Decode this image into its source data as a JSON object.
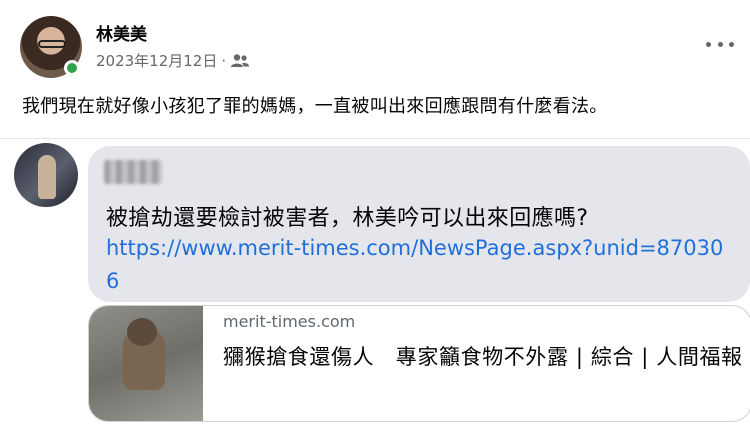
{
  "post": {
    "author": "林美美",
    "date": "2023年12月12日",
    "separator": "·",
    "audience_icon": "friends-icon",
    "text": "我們現在就好像小孩犯了罪的媽媽，一直被叫出來回應跟問有什麼看法。"
  },
  "comment": {
    "text": "被搶劫還要檢討被害者，林美吟可以出來回應嗎?",
    "link": "https://www.merit-times.com/NewsPage.aspx?unid=870306",
    "preview": {
      "domain": "merit-times.com",
      "title": "獼猴搶食還傷人　專家籲食物不外露 | 綜合 | 人間福報"
    }
  },
  "colors": {
    "link": "#216fdb",
    "bubble": "#e4e6eb",
    "online": "#31a24c",
    "meta": "#65676b"
  }
}
